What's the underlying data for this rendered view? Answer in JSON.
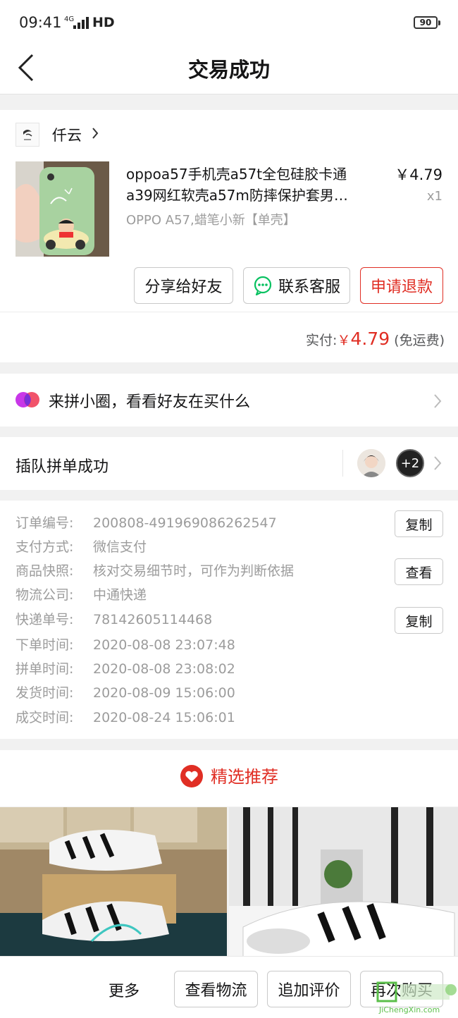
{
  "status_bar": {
    "time": "09:41",
    "signal": "4G",
    "network": "HD",
    "battery": "90"
  },
  "nav": {
    "title": "交易成功"
  },
  "order": {
    "shop_name": "仟云",
    "goods_title_line1": "oppoa57手机壳a57t全包硅胶卡通",
    "goods_title_line2": "a39网红软壳a57m防摔保护套男…",
    "price": "￥4.79",
    "quantity": "x1",
    "spec": "OPPO A57,蜡笔小新【单壳】",
    "actions": {
      "share": "分享给好友",
      "contact": "联系客服",
      "refund": "申请退款"
    },
    "paid_label": "实付:",
    "paid_currency": "￥",
    "paid_amount": "4.79",
    "paid_note": "(免运费)"
  },
  "circle": {
    "label": "来拼小圈，看看好友在买什么"
  },
  "group": {
    "label": "插队拼单成功",
    "extra_count": "+2"
  },
  "info": {
    "rows": [
      {
        "label": "订单编号:",
        "value": "200808-491969086262547",
        "button": "复制"
      },
      {
        "label": "支付方式:",
        "value": "微信支付"
      },
      {
        "label": "商品快照:",
        "value": "核对交易细节时，可作为判断依据",
        "button": "查看"
      },
      {
        "label": "物流公司:",
        "value": "中通快递"
      },
      {
        "label": "快递单号:",
        "value": "78142605114468",
        "button": "复制"
      },
      {
        "label": "下单时间:",
        "value": "2020-08-08 23:07:48"
      },
      {
        "label": "拼单时间:",
        "value": "2020-08-08 23:08:02"
      },
      {
        "label": "发货时间:",
        "value": "2020-08-09 15:06:00"
      },
      {
        "label": "成交时间:",
        "value": "2020-08-24 15:06:01"
      }
    ]
  },
  "recommend": {
    "title": "精选推荐"
  },
  "bottom": {
    "more": "更多",
    "logistics": "查看物流",
    "review": "追加评价",
    "rebuy": "再次购买"
  },
  "watermark": {
    "text": "JiChengXin.com"
  },
  "colors": {
    "accent": "#e02e24",
    "wechat": "#07c160",
    "muted": "#9c9c9c"
  }
}
